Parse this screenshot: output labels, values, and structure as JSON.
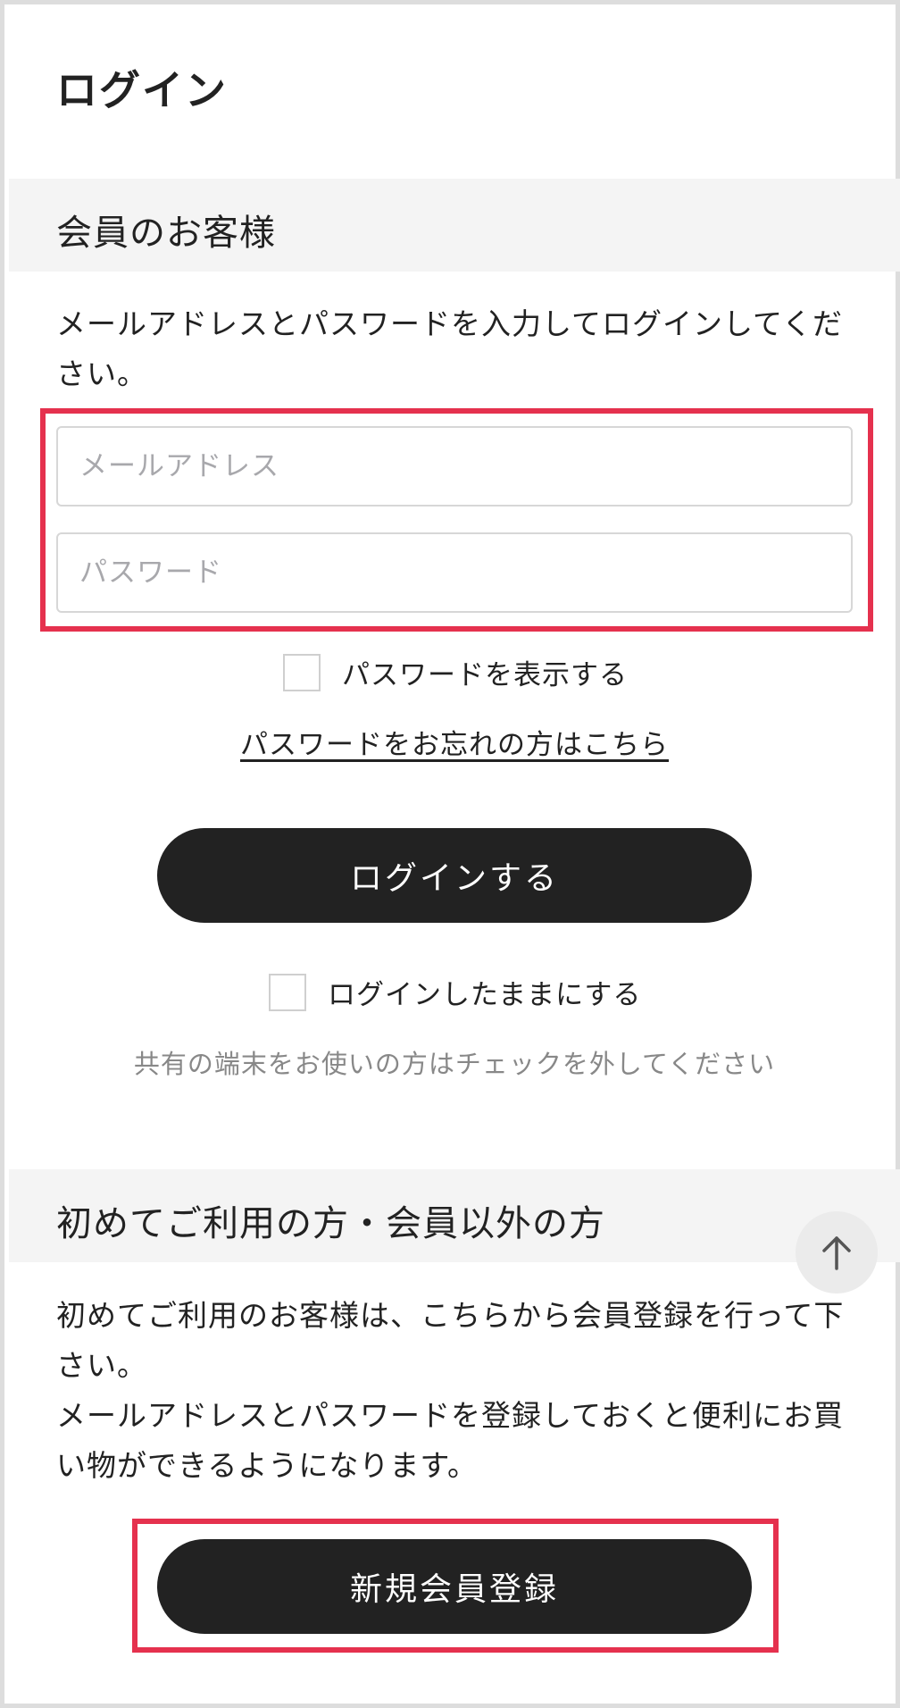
{
  "page": {
    "title": "ログイン"
  },
  "member_section": {
    "heading": "会員のお客様",
    "instruction": "メールアドレスとパスワードを入力してログインしてください。",
    "email_placeholder": "メールアドレス",
    "password_placeholder": "パスワード",
    "show_password_label": "パスワードを表示する",
    "forgot_password_link": "パスワードをお忘れの方はこちら",
    "login_button": "ログインする",
    "stay_logged_in_label": "ログインしたままにする",
    "shared_device_note": "共有の端末をお使いの方はチェックを外してください"
  },
  "guest_section": {
    "heading": "初めてご利用の方・会員以外の方",
    "description_line1": "初めてご利用のお客様は、こちらから会員登録を行って下さい。",
    "description_line2": "メールアドレスとパスワードを登録しておくと便利にお買い物ができるようになります。",
    "register_button": "新規会員登録"
  },
  "icons": {
    "scroll_top": "arrow-up-icon"
  },
  "colors": {
    "highlight": "#e5314e",
    "button": "#222222",
    "section_band": "#f4f4f4"
  }
}
